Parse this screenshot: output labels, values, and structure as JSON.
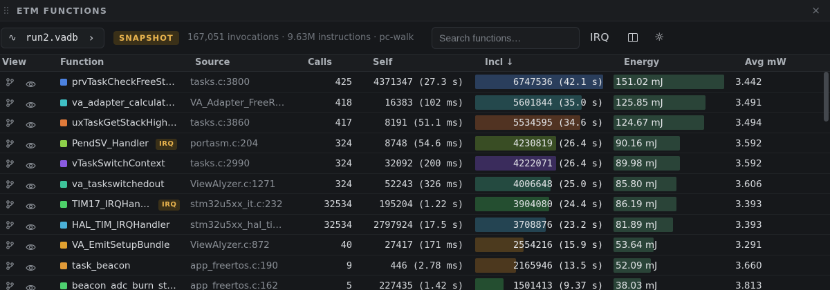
{
  "panel": {
    "title": "ETM FUNCTIONS",
    "close_glyph": "×"
  },
  "toolbar": {
    "file_glyph": "∿",
    "file": "run2.vadb",
    "chevron": "›",
    "badge": "SNAPSHOT",
    "stats": "167,051 invocations · 9.63M instructions · pc-walk",
    "search_placeholder": "Search functions…",
    "irq_label": "IRQ",
    "gear_glyph": "☼"
  },
  "columns": {
    "view": "View",
    "function": "Function",
    "source": "Source",
    "calls": "Calls",
    "self": "Self",
    "incl": "Incl ↓",
    "energy": "Energy",
    "avg": "Avg mW"
  },
  "colors": {
    "accent": "#e8b34e",
    "energy_bar": "#2a4438"
  },
  "irq_badge_label": "IRQ",
  "rows": [
    {
      "function": "prvTaskCheckFreeSt…",
      "irq": false,
      "source": "tasks.c:3800",
      "calls": "425",
      "self": "4371347 (27.3 s)",
      "incl": "6747536 (42.1 s)",
      "incl_frac": 1.0,
      "energy": "151.02 mJ",
      "energy_frac": 1.0,
      "avg_mw": "3.442",
      "swatch": "#4c82e0",
      "bar": "#2a3e5c"
    },
    {
      "function": "va_adapter_calculat…",
      "irq": false,
      "source": "VA_Adapter_FreeR…",
      "calls": "418",
      "self": "16383 (102 ms)",
      "incl": "5601844 (35.0 s)",
      "incl_frac": 0.83,
      "energy": "125.85 mJ",
      "energy_frac": 0.83,
      "avg_mw": "3.491",
      "swatch": "#3fbfc4",
      "bar": "#24484c"
    },
    {
      "function": "uxTaskGetStackHigh…",
      "irq": false,
      "source": "tasks.c:3860",
      "calls": "417",
      "self": "8191 (51.1 ms)",
      "incl": "5534595 (34.6 s)",
      "incl_frac": 0.82,
      "energy": "124.67 mJ",
      "energy_frac": 0.82,
      "avg_mw": "3.494",
      "swatch": "#e07a3a",
      "bar": "#513322"
    },
    {
      "function": "PendSV_Handler",
      "irq": true,
      "source": "portasm.c:204",
      "calls": "324",
      "self": "8748 (54.6 ms)",
      "incl": "4230819 (26.4 s)",
      "incl_frac": 0.63,
      "energy": "90.16 mJ",
      "energy_frac": 0.6,
      "avg_mw": "3.592",
      "swatch": "#8ed04a",
      "bar": "#394d24"
    },
    {
      "function": "vTaskSwitchContext",
      "irq": false,
      "source": "tasks.c:2990",
      "calls": "324",
      "self": "32092 (200 ms)",
      "incl": "4222071 (26.4 s)",
      "incl_frac": 0.63,
      "energy": "89.98 mJ",
      "energy_frac": 0.6,
      "avg_mw": "3.592",
      "swatch": "#8a5ae0",
      "bar": "#3a2c5c"
    },
    {
      "function": "va_taskswitchedout",
      "irq": false,
      "source": "ViewAlyzer.c:1271",
      "calls": "324",
      "self": "52243 (326 ms)",
      "incl": "4006648 (25.0 s)",
      "incl_frac": 0.59,
      "energy": "85.80 mJ",
      "energy_frac": 0.57,
      "avg_mw": "3.606",
      "swatch": "#3ec39a",
      "bar": "#244a40"
    },
    {
      "function": "TIM17_IRQHan…",
      "irq": true,
      "source": "stm32u5xx_it.c:232",
      "calls": "32534",
      "self": "195204 (1.22 s)",
      "incl": "3904080 (24.4 s)",
      "incl_frac": 0.58,
      "energy": "86.19 mJ",
      "energy_frac": 0.57,
      "avg_mw": "3.393",
      "swatch": "#4ed06a",
      "bar": "#244e30"
    },
    {
      "function": "HAL_TIM_IRQHandler",
      "irq": false,
      "source": "stm32u5xx_hal_ti…",
      "calls": "32534",
      "self": "2797924 (17.5 s)",
      "incl": "3708876 (23.2 s)",
      "incl_frac": 0.55,
      "energy": "81.89 mJ",
      "energy_frac": 0.54,
      "avg_mw": "3.393",
      "swatch": "#4ab0d8",
      "bar": "#244452"
    },
    {
      "function": "VA_EmitSetupBundle",
      "irq": false,
      "source": "ViewAlyzer.c:872",
      "calls": "40",
      "self": "27417 (171 ms)",
      "incl": "2554216 (15.9 s)",
      "incl_frac": 0.38,
      "energy": "53.64 mJ",
      "energy_frac": 0.36,
      "avg_mw": "3.291",
      "swatch": "#e0a030",
      "bar": "#4c3a1e"
    },
    {
      "function": "task_beacon",
      "irq": false,
      "source": "app_freertos.c:190",
      "calls": "9",
      "self": "446 (2.78 ms)",
      "incl": "2165946 (13.5 s)",
      "incl_frac": 0.32,
      "energy": "52.09 mJ",
      "energy_frac": 0.34,
      "avg_mw": "3.660",
      "swatch": "#e09a38",
      "bar": "#4c381e"
    },
    {
      "function": "beacon_adc_burn_st…",
      "irq": false,
      "source": "app_freertos.c:162",
      "calls": "5",
      "self": "227435 (1.42 s)",
      "incl": "1501413 (9.37 s)",
      "incl_frac": 0.22,
      "energy": "38.03 mJ",
      "energy_frac": 0.25,
      "avg_mw": "3.813",
      "swatch": "#4ed070",
      "bar": "#244e30"
    }
  ]
}
